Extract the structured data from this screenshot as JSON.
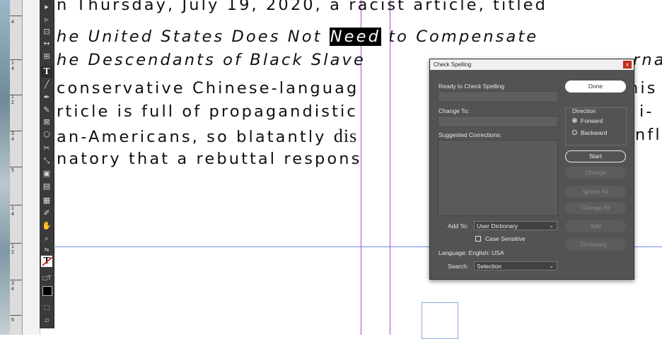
{
  "document": {
    "line1": "n Thursday, July 19, 2020, a racist article, titled",
    "line2_pre": "he United States Does Not ",
    "line2_hl": "Need",
    "line2_post": " to Compensate",
    "line3": "he Descendants of Black Slave",
    "line3_tail": "rna",
    "line4": " conservative Chinese-languag",
    "line4_tail": "nis",
    "line5": "rticle is full of propagandistic",
    "line5_tail": "i-",
    "line6_pre": "an-Americans, so blatantly ",
    "line6_serif": "dis",
    "line6_tail": "nfl",
    "line7": "natory that a rebuttal respons"
  },
  "ruler": {
    "labels": [
      "4",
      "1",
      "4",
      "1",
      "2",
      "3",
      "4",
      "5",
      "1",
      "4",
      "1",
      "2",
      "3",
      "4",
      "6"
    ]
  },
  "toolbar": {
    "icons": [
      "selection-tool-icon",
      "direct-selection-tool-icon",
      "page-tool-icon",
      "gap-tool-icon",
      "content-collector-icon",
      "type-tool-icon",
      "line-tool-icon",
      "pen-tool-icon",
      "pencil-tool-icon",
      "rectangle-frame-tool-icon",
      "ellipse-tool-icon",
      "scissors-tool-icon",
      "free-transform-tool-icon",
      "gradient-swatch-tool-icon",
      "gradient-feather-tool-icon",
      "note-tool-icon",
      "eyedropper-tool-icon",
      "hand-tool-icon",
      "zoom-tool-icon"
    ]
  },
  "dialog": {
    "title": "Check Spelling",
    "close": "x",
    "status": "Ready to Check Spelling",
    "change_to_label": "Change To:",
    "suggested_label": "Suggested Corrections:",
    "direction_label": "Direction",
    "forward": "Forward",
    "backward": "Backward",
    "direction_selected": "Forward",
    "done": "Done",
    "start": "Start",
    "change": "Change",
    "ignore_all": "Ignore All",
    "change_all": "Change All",
    "add": "Add",
    "dictionary": "Dictionary...",
    "add_to_label": "Add To:",
    "add_to_value": "User Dictionary",
    "case_sensitive": "Case Sensitive",
    "case_sensitive_checked": false,
    "language": "Language: English: USA",
    "search_label": "Search:",
    "search_value": "Selection"
  }
}
